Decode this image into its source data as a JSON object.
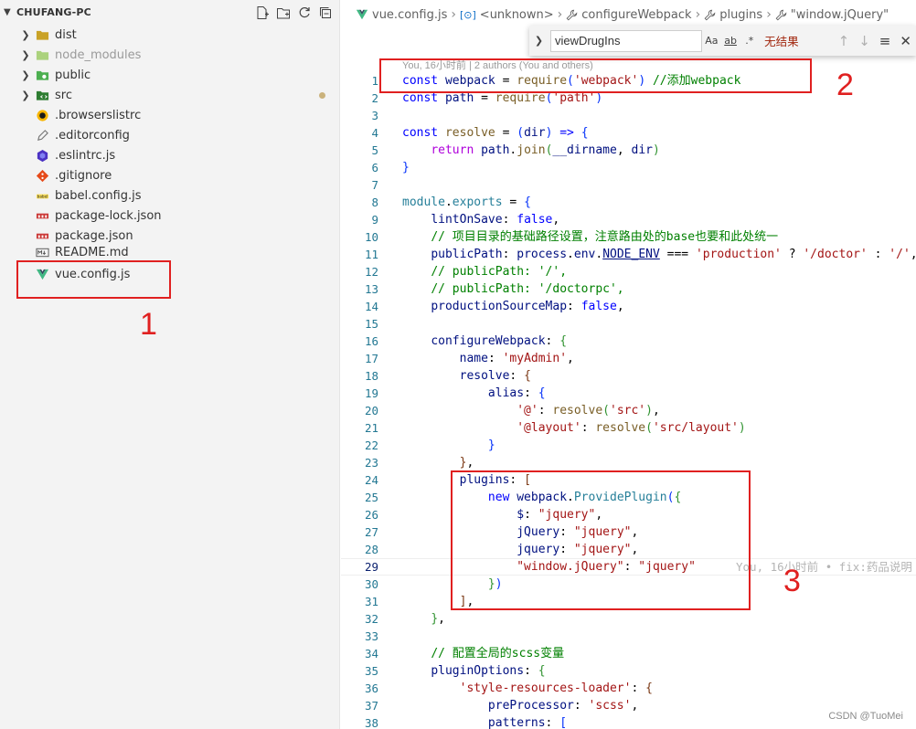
{
  "explorer": {
    "title": "CHUFANG-PC",
    "actions": [
      "new-file-icon",
      "new-folder-icon",
      "refresh-icon",
      "collapse-all-icon"
    ],
    "items": [
      {
        "name": "dist",
        "kind": "folder",
        "icon": "folder-dist-icon",
        "color": "#c9a227"
      },
      {
        "name": "node_modules",
        "kind": "folder",
        "icon": "folder-node-icon",
        "color": "#8bc34a",
        "dim": true
      },
      {
        "name": "public",
        "kind": "folder",
        "icon": "folder-public-icon",
        "color": "#4caf50"
      },
      {
        "name": "src",
        "kind": "folder",
        "icon": "folder-src-icon",
        "color": "#2e7d32",
        "modified": true
      },
      {
        "name": ".browserslistrc",
        "kind": "file",
        "icon": "browserslist-icon",
        "color": "#f7b500"
      },
      {
        "name": ".editorconfig",
        "kind": "file",
        "icon": "editorconfig-icon",
        "color": "#777777"
      },
      {
        "name": ".eslintrc.js",
        "kind": "file",
        "icon": "eslint-icon",
        "color": "#4b32c3"
      },
      {
        "name": ".gitignore",
        "kind": "file",
        "icon": "git-icon",
        "color": "#e64a19"
      },
      {
        "name": "babel.config.js",
        "kind": "file",
        "icon": "babel-icon",
        "color": "#f5da55"
      },
      {
        "name": "package-lock.json",
        "kind": "file",
        "icon": "npm-icon",
        "color": "#cb3837"
      },
      {
        "name": "package.json",
        "kind": "file",
        "icon": "npm-icon",
        "color": "#cb3837"
      },
      {
        "name": "README.md",
        "kind": "file",
        "icon": "markdown-icon",
        "color": "#555555"
      },
      {
        "name": "vue.config.js",
        "kind": "file",
        "icon": "vue-icon",
        "color": "#41b883"
      }
    ]
  },
  "breadcrumb": [
    {
      "label": "vue.config.js",
      "icon": "vue-icon"
    },
    {
      "label": "<unknown>",
      "icon": "module-icon"
    },
    {
      "label": "configureWebpack",
      "icon": "wrench-icon"
    },
    {
      "label": "plugins",
      "icon": "wrench-icon"
    },
    {
      "label": "\"window.jQuery\"",
      "icon": "wrench-icon"
    }
  ],
  "find": {
    "value": "viewDrugIns",
    "options": [
      "Aa",
      "ab",
      ".*"
    ],
    "result": "无结果"
  },
  "editor": {
    "blame_header": "You, 16小时前 | 2 authors (You and others)",
    "inline_blame": "You, 16小时前 • fix:药品说明",
    "current_line": 29
  },
  "annotations": {
    "box1": "1",
    "box2": "2",
    "box3": "3"
  },
  "watermark": "CSDN @TuoMei",
  "colors": {
    "annotation": "#e02020",
    "keyword": "#0000ff",
    "string": "#a31515",
    "comment": "#008000",
    "line_number": "#237893"
  }
}
